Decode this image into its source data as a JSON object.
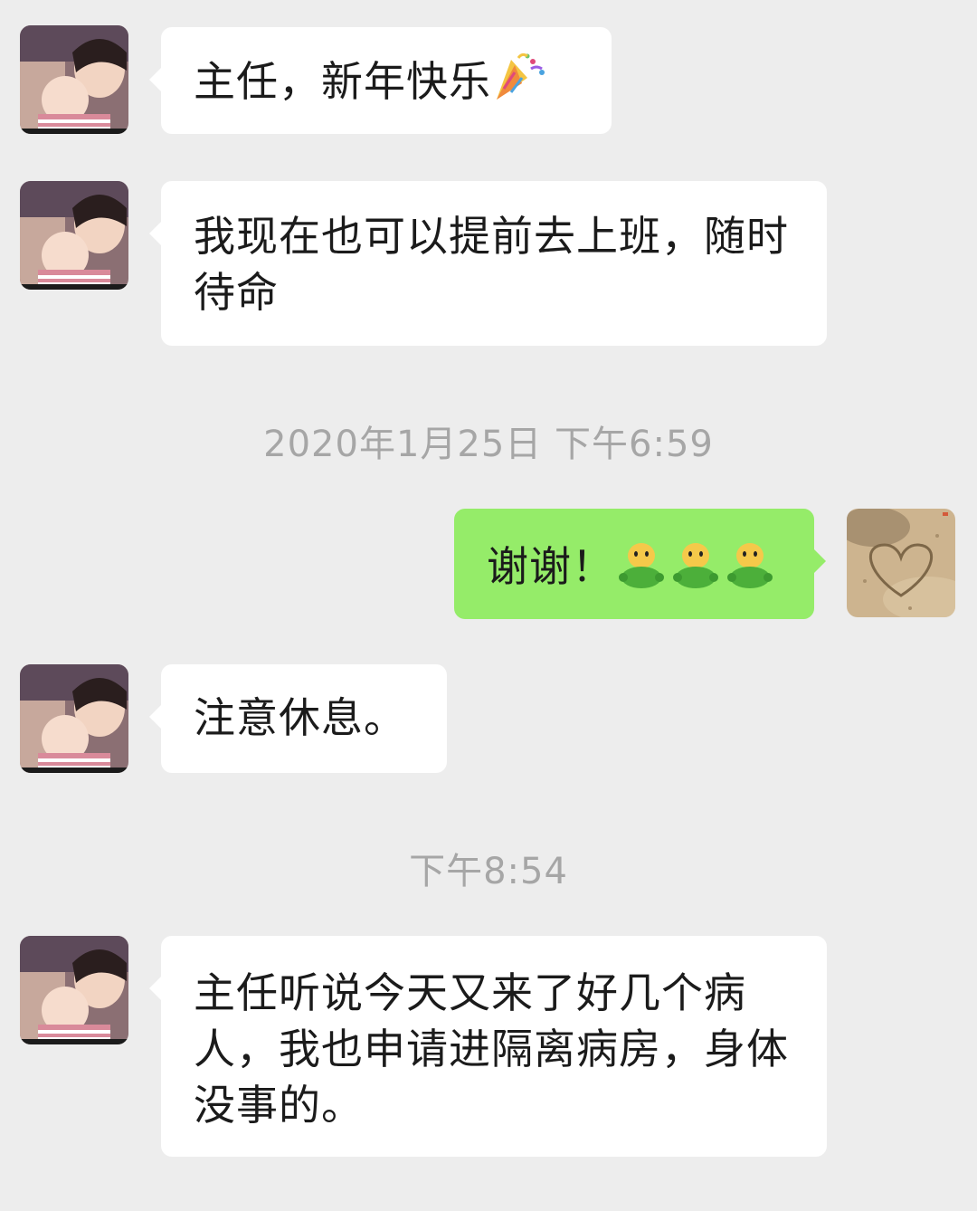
{
  "messages": [
    {
      "type": "incoming",
      "text": "主任，新年快乐",
      "emoji": "party-popper-icon"
    },
    {
      "type": "incoming",
      "text": "我现在也可以提前去上班，随时待命"
    },
    {
      "type": "timestamp",
      "text": "2020年1月25日 下午6:59"
    },
    {
      "type": "outgoing",
      "text": "谢谢！",
      "emoji": "green-figure-icon",
      "emoji_count": 3
    },
    {
      "type": "incoming",
      "text": "注意休息。"
    },
    {
      "type": "timestamp",
      "text": "下午8:54"
    },
    {
      "type": "incoming",
      "text": "主任听说今天又来了好几个病人，我也申请进隔离病房，身体没事的。"
    }
  ],
  "colors": {
    "background": "#ededed",
    "incoming_bubble": "#ffffff",
    "outgoing_bubble": "#95ec69",
    "timestamp_text": "#a6a6a6",
    "message_text": "#1b1b1b"
  }
}
